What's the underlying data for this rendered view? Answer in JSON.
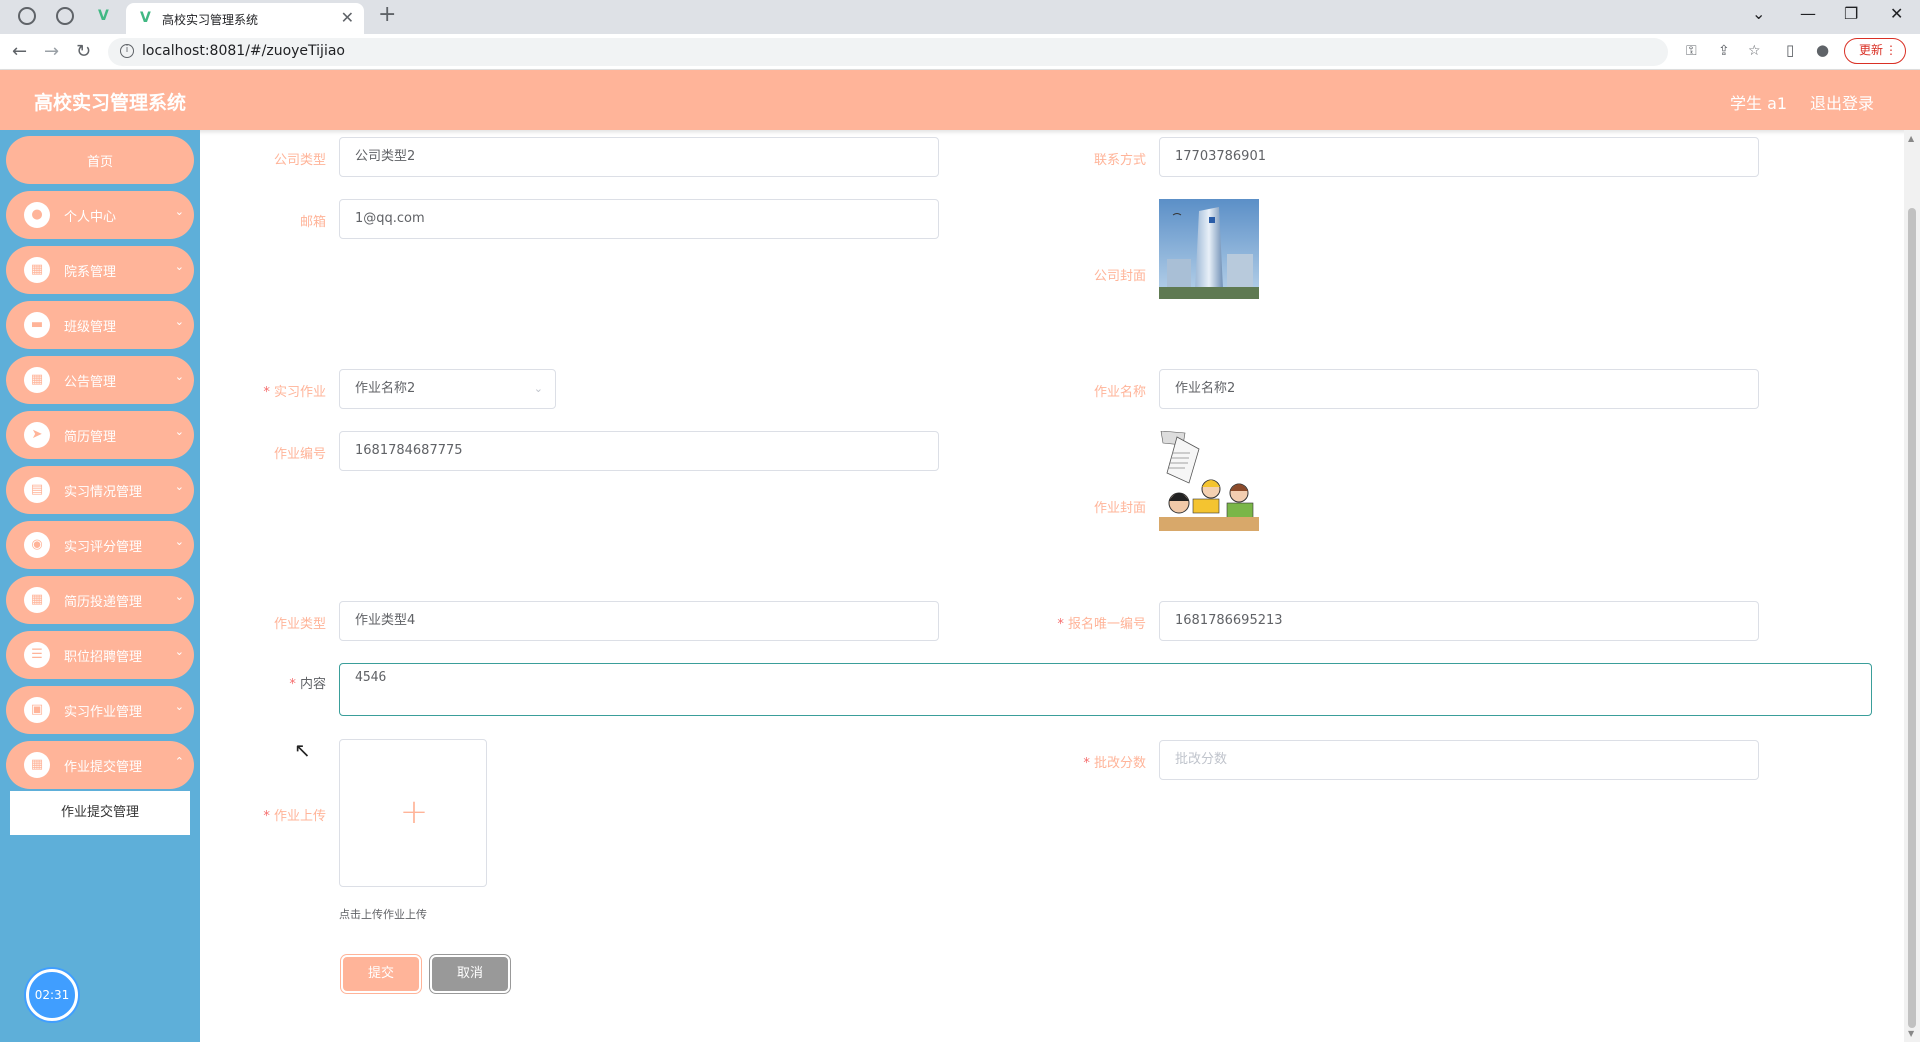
{
  "browser": {
    "tab_title": "高校实习管理系统",
    "url": "localhost:8081/#/zuoyeTijiao",
    "update_label": "更新"
  },
  "header": {
    "title": "高校实习管理系统",
    "user": "学生 a1",
    "logout": "退出登录"
  },
  "sidebar": {
    "items": [
      {
        "label": "首页",
        "icon": "home"
      },
      {
        "label": "个人中心",
        "icon": "user-icon"
      },
      {
        "label": "院系管理",
        "icon": "grid-icon"
      },
      {
        "label": "班级管理",
        "icon": "briefcase-icon"
      },
      {
        "label": "公告管理",
        "icon": "grid-icon"
      },
      {
        "label": "简历管理",
        "icon": "send-icon"
      },
      {
        "label": "实习情况管理",
        "icon": "clipboard-icon"
      },
      {
        "label": "实习评分管理",
        "icon": "pin-icon"
      },
      {
        "label": "简历投递管理",
        "icon": "grid-icon"
      },
      {
        "label": "职位招聘管理",
        "icon": "list-icon"
      },
      {
        "label": "实习作业管理",
        "icon": "doc-icon"
      },
      {
        "label": "作业提交管理",
        "icon": "grid-icon"
      }
    ],
    "submenu_label": "作业提交管理",
    "timer": "02:31"
  },
  "form": {
    "company_type": {
      "label": "公司类型",
      "value": "公司类型2"
    },
    "contact": {
      "label": "联系方式",
      "value": "17703786901"
    },
    "email": {
      "label": "邮箱",
      "value": "1@qq.com"
    },
    "company_cover": {
      "label": "公司封面"
    },
    "assignment": {
      "label": "实习作业",
      "value": "作业名称2"
    },
    "assignment_name": {
      "label": "作业名称",
      "value": "作业名称2"
    },
    "assignment_no": {
      "label": "作业编号",
      "value": "1681784687775"
    },
    "assignment_cover": {
      "label": "作业封面"
    },
    "assignment_type": {
      "label": "作业类型",
      "value": "作业类型4"
    },
    "signup_no": {
      "label": "报名唯一编号",
      "value": "1681786695213"
    },
    "content": {
      "label": "内容",
      "value": "4546"
    },
    "upload": {
      "label": "作业上传",
      "hint": "点击上传作业上传"
    },
    "score": {
      "label": "批改分数",
      "placeholder": "批改分数"
    },
    "submit_label": "提交",
    "cancel_label": "取消"
  },
  "colors": {
    "accent": "#ffb499",
    "sidebar": "#5eafd9",
    "required": "#f56c6c"
  }
}
